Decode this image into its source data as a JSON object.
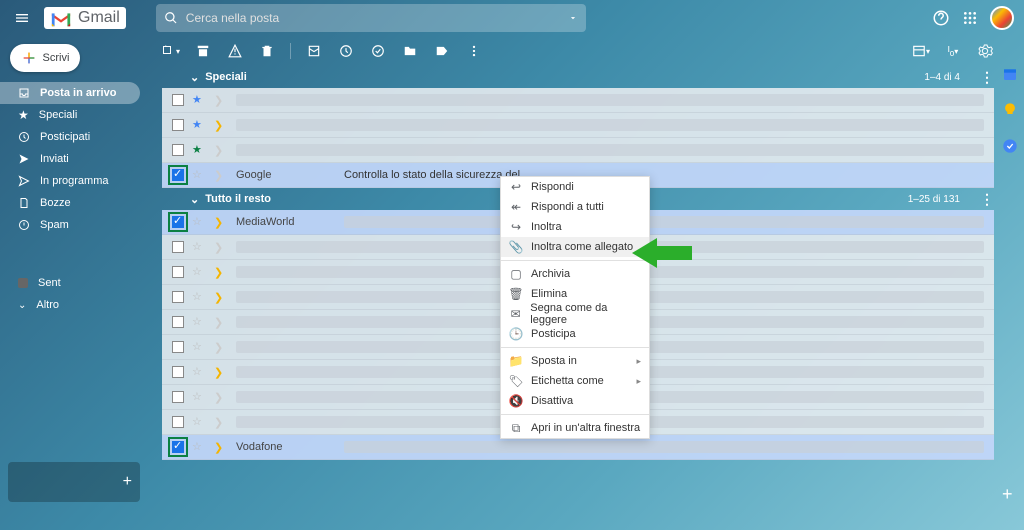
{
  "header": {
    "brand": "Gmail",
    "search_placeholder": "Cerca nella posta"
  },
  "compose": {
    "label": "Scrivi"
  },
  "sidebar": {
    "items": [
      {
        "label": "Posta in arrivo",
        "icon": "inbox",
        "active": true
      },
      {
        "label": "Speciali",
        "icon": "star"
      },
      {
        "label": "Posticipati",
        "icon": "clock"
      },
      {
        "label": "Inviati",
        "icon": "send"
      },
      {
        "label": "In programma",
        "icon": "schedule"
      },
      {
        "label": "Bozze",
        "icon": "draft"
      },
      {
        "label": "Spam",
        "icon": "spam"
      }
    ],
    "sent_label": "Sent",
    "altro_label": "Altro"
  },
  "sections": {
    "speciali": {
      "title": "Speciali",
      "count": "1–4 di 4"
    },
    "tutto": {
      "title": "Tutto il resto",
      "count": "1–25 di 131"
    }
  },
  "rows": {
    "google": "Google",
    "mediaworld": "MediaWorld",
    "vodafone": "Vodafone",
    "google_subject": "Controlla lo stato della sicurezza del"
  },
  "context_menu": {
    "reply": "Rispondi",
    "reply_all": "Rispondi a tutti",
    "forward": "Inoltra",
    "forward_attach": "Inoltra come allegato",
    "archive": "Archivia",
    "delete": "Elimina",
    "mark_unread": "Segna come da leggere",
    "snooze": "Posticipa",
    "move_to": "Sposta in",
    "label_as": "Etichetta come",
    "mute": "Disattiva",
    "open_window": "Apri in un'altra finestra"
  }
}
